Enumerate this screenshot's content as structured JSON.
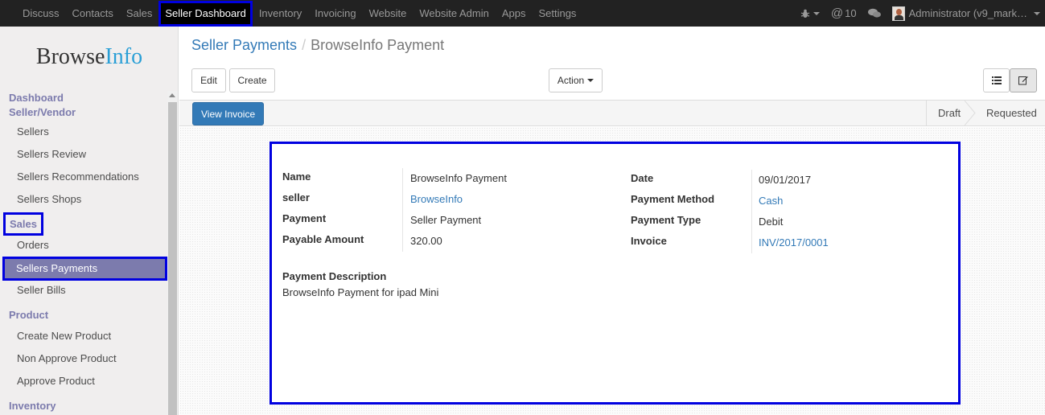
{
  "topnav": {
    "items": [
      "Discuss",
      "Contacts",
      "Sales",
      "Seller Dashboard",
      "Inventory",
      "Invoicing",
      "Website",
      "Website Admin",
      "Apps",
      "Settings"
    ],
    "active": "Seller Dashboard",
    "messages_count": "10",
    "user": "Administrator (v9_mark…"
  },
  "sidebar": {
    "logo_main": "Browse",
    "logo_accent": "Info",
    "sections": [
      {
        "title": "Dashboard Seller/Vendor",
        "items": [
          "Sellers",
          "Sellers Review",
          "Sellers Recommendations",
          "Sellers Shops"
        ]
      },
      {
        "title": "Sales",
        "items": [
          "Orders",
          "Sellers Payments",
          "Seller Bills"
        ]
      },
      {
        "title": "Product",
        "items": [
          "Create New Product",
          "Non Approve Product",
          "Approve Product"
        ]
      },
      {
        "title": "Inventory",
        "items": []
      }
    ],
    "selected": "Sellers Payments"
  },
  "breadcrumb": {
    "parent": "Seller Payments",
    "separator": "/",
    "current": "BrowseInfo Payment"
  },
  "buttons": {
    "edit": "Edit",
    "create": "Create",
    "action": "Action",
    "view_invoice": "View Invoice"
  },
  "statusbar": {
    "stages": [
      "Draft",
      "Requested"
    ],
    "current": "Requested"
  },
  "form": {
    "left": [
      {
        "label": "Name",
        "value": "BrowseInfo Payment",
        "link": false
      },
      {
        "label": "seller",
        "value": "BrowseInfo",
        "link": true
      },
      {
        "label": "Payment",
        "value": "Seller Payment",
        "link": false
      },
      {
        "label": "Payable Amount",
        "value": "320.00",
        "link": false
      }
    ],
    "right": [
      {
        "label": "Date",
        "value": "09/01/2017",
        "link": false
      },
      {
        "label": "Payment Method",
        "value": "Cash",
        "link": true
      },
      {
        "label": "Payment Type",
        "value": "Debit",
        "link": false
      },
      {
        "label": "Invoice",
        "value": "INV/2017/0001",
        "link": true
      }
    ],
    "description_label": "Payment Description",
    "description": "BrowseInfo Payment for ipad Mini"
  },
  "colors": {
    "highlight": "#0000e0",
    "primary": "#337ab7",
    "sidebar_accent": "#7c7bad"
  }
}
